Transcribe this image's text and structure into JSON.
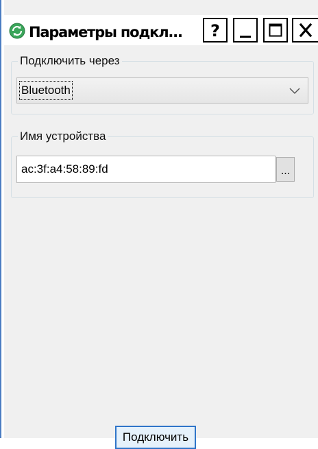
{
  "window": {
    "title": "Параметры подкл...",
    "app_icon": "refresh-icon",
    "buttons": {
      "help_label": "?",
      "minimize_icon": "minimize-icon",
      "maximize_icon": "maximize-icon",
      "close_icon": "close-icon"
    }
  },
  "connect_via": {
    "label": "Подключить через",
    "selected": "Bluetooth",
    "dropdown_icon": "chevron-down-icon"
  },
  "device": {
    "label": "Имя устройства",
    "value": "ac:3f:a4:58:89:fd",
    "browse_label": "..."
  },
  "connect_button": {
    "label": "Подключить"
  },
  "colors": {
    "accent": "#2f75c9",
    "window_bg": "#f0f0f0",
    "icon_green": "#3aa55a"
  }
}
